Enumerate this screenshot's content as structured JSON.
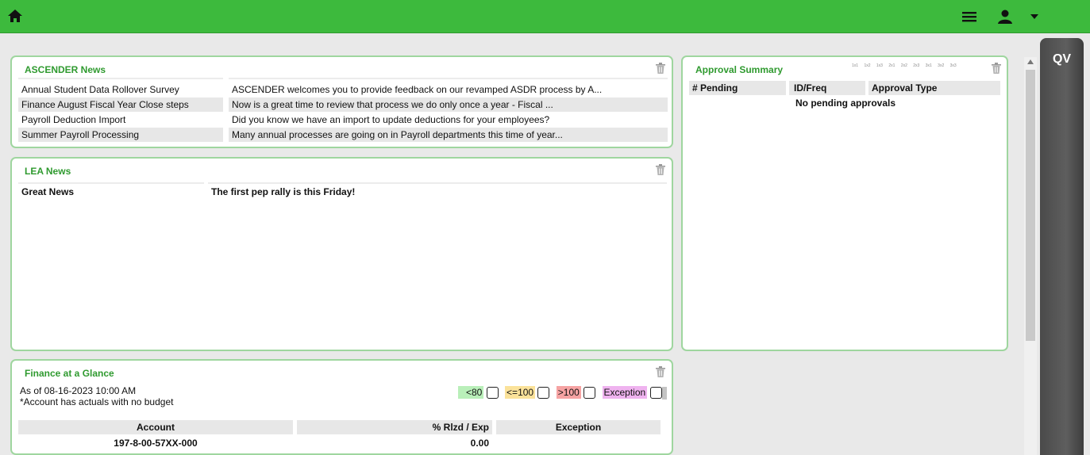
{
  "topbar": {
    "color": "#3dba3d"
  },
  "icons": {
    "home": "home-icon",
    "menu": "menu-icon",
    "user": "user-icon",
    "caret": "caret-down-icon",
    "trash": "trash-icon"
  },
  "ascender_news": {
    "title": "ASCENDER News",
    "items": [
      {
        "title": "Annual Student Data Rollover Survey",
        "summary": "ASCENDER welcomes you to provide feedback on our revamped ASDR process by A..."
      },
      {
        "title": "Finance August Fiscal Year Close steps",
        "summary": "Now is a great time to review that process we do only once a year - Fiscal ..."
      },
      {
        "title": "Payroll Deduction Import",
        "summary": "Did you know we have an import to update deductions for your employees?"
      },
      {
        "title": "Summer Payroll Processing",
        "summary": "Many annual processes are going on in Payroll departments this time of year..."
      }
    ]
  },
  "lea_news": {
    "title": "LEA News",
    "items": [
      {
        "title": "Great News",
        "summary": "The first pep rally is this Friday!"
      }
    ]
  },
  "approval": {
    "title": "Approval Summary",
    "layout_options": [
      "1x1",
      "1x2",
      "1x3",
      "2x1",
      "2x2",
      "2x3",
      "3x1",
      "3x2",
      "3x3"
    ],
    "columns": [
      "# Pending",
      "ID/Freq",
      "Approval Type"
    ],
    "empty_message": "No pending approvals"
  },
  "finance": {
    "title": "Finance at a Glance",
    "as_of": "As of 08-16-2023 10:00 AM",
    "note": "*Account has actuals with no budget",
    "filters": [
      {
        "label": "<80",
        "color": "#b9efb9"
      },
      {
        "label": "<=100",
        "color": "#fbe29a"
      },
      {
        "label": ">100",
        "color": "#f6a3a3"
      },
      {
        "label": "Exception",
        "color": "#efb3ef"
      }
    ],
    "columns": [
      "Account",
      "% Rlzd / Exp",
      "Exception"
    ],
    "rows": [
      {
        "account": "197-8-00-57XX-000",
        "pct": "0.00",
        "exception": ""
      }
    ]
  },
  "quickview": {
    "label": "QV"
  }
}
